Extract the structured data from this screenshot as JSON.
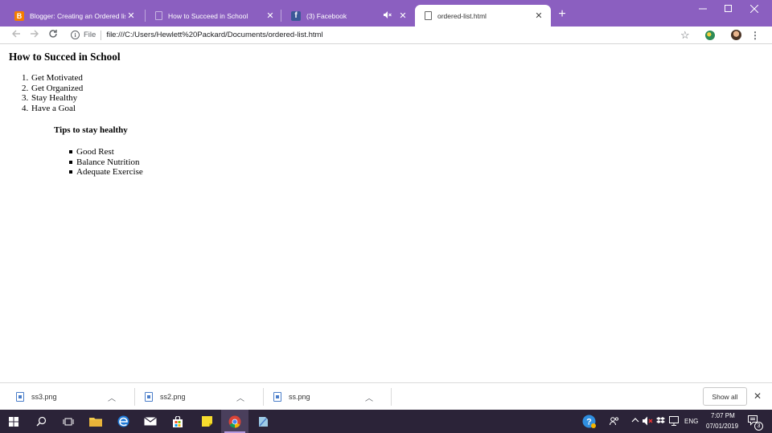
{
  "tabs": [
    {
      "title": "Blogger: Creating an Ordered list",
      "icon": "blogger-icon",
      "active": false
    },
    {
      "title": "How to Succeed in School",
      "icon": "document-icon",
      "active": false
    },
    {
      "title": "(3) Facebook",
      "icon": "facebook-icon",
      "active": false,
      "muted_icon": "speaker-mute-icon"
    },
    {
      "title": "ordered-list.html",
      "icon": "document-icon",
      "active": true
    }
  ],
  "toolbar": {
    "scheme_label": "File",
    "url": "file:///C:/Users/Hewlett%20Packard/Documents/ordered-list.html"
  },
  "page": {
    "heading": "How to Succed in School",
    "ordered_items": [
      {
        "num": "1.",
        "text": "Get Motivated"
      },
      {
        "num": "2.",
        "text": "Get Organized"
      },
      {
        "num": "3.",
        "text": "Stay Healthy"
      },
      {
        "num": "4.",
        "text": "Have a Goal"
      }
    ],
    "subheading": "Tips to stay healthy",
    "tips": [
      "Good Rest",
      "Balance Nutrition",
      "Adequate Exercise"
    ]
  },
  "downloads": {
    "items": [
      {
        "name": "ss3.png"
      },
      {
        "name": "ss2.png"
      },
      {
        "name": "ss.png"
      }
    ],
    "show_all_label": "Show all"
  },
  "taskbar": {
    "language": "ENG",
    "time": "7:07 PM",
    "date": "07/01/2019",
    "notification_count": "3"
  },
  "colors": {
    "tabstrip": "#8b5fc0",
    "taskbar": "#2b2338"
  }
}
